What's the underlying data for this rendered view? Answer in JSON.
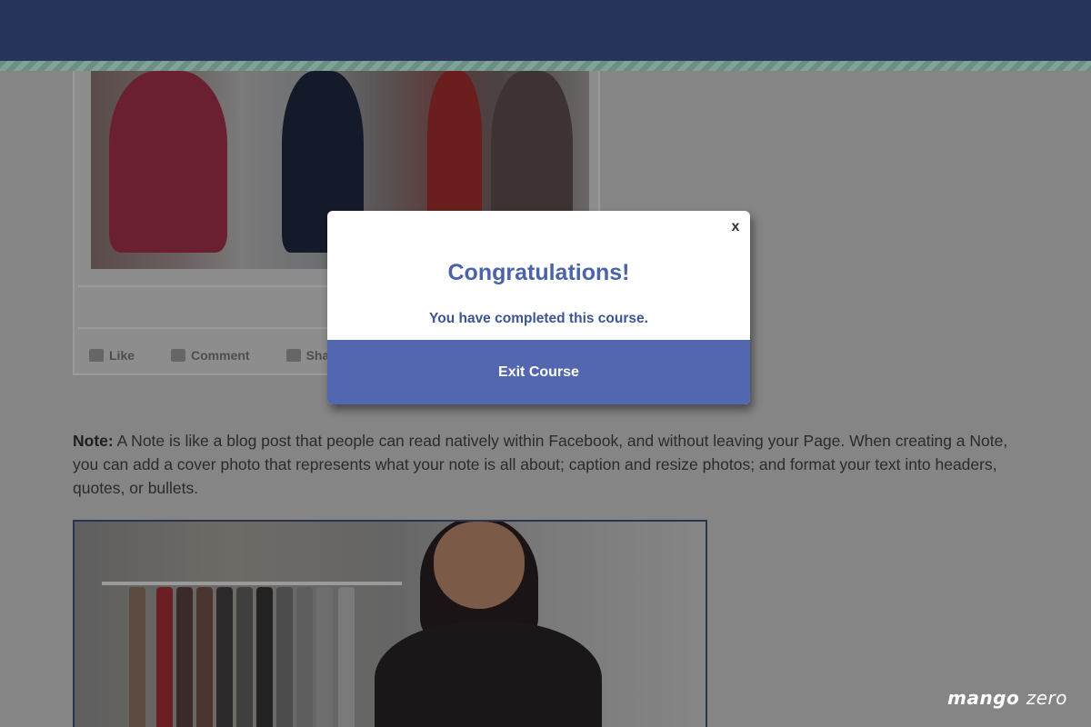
{
  "modal": {
    "close_label": "x",
    "title": "Congratulations!",
    "message": "You have completed this course.",
    "button_label": "Exit Course"
  },
  "post": {
    "actions": [
      {
        "label": "Like",
        "icon": "thumbs-up-icon"
      },
      {
        "label": "Comment",
        "icon": "comment-icon"
      },
      {
        "label": "Sha",
        "icon": "share-icon"
      }
    ]
  },
  "note": {
    "label": "Note:",
    "text": " A Note is like a blog post that people can read natively within Facebook, and without leaving your Page. When creating a Note, you can add a cover photo that represents what your note is all about; caption and resize photos; and format your text into headers, quotes, or bullets."
  },
  "watermark": {
    "brand": "mango",
    "accent": "zero"
  },
  "colors": {
    "topbar": "#27355d",
    "modal_title": "#4a63a9",
    "modal_button": "#5267b0",
    "overlay": "#858585"
  }
}
